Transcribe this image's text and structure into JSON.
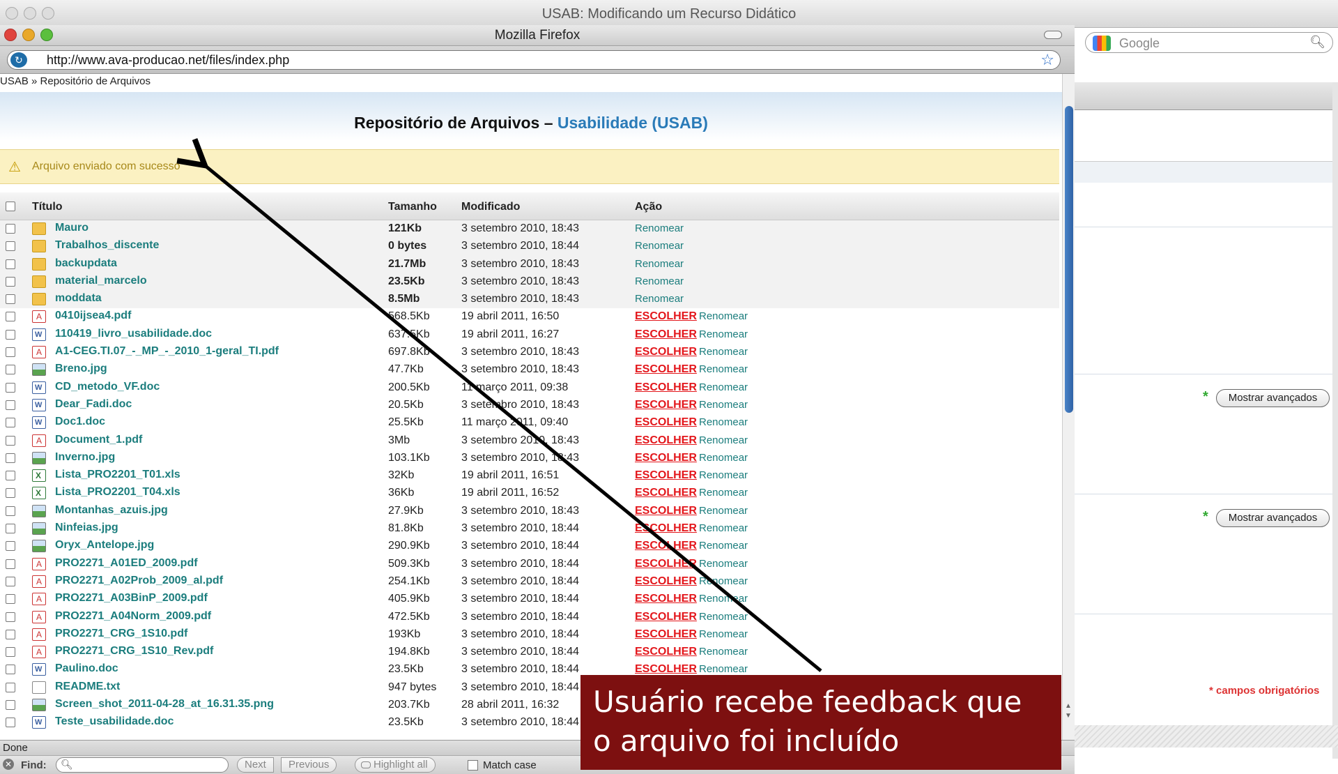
{
  "outer_window": {
    "title": "USAB: Modificando um Recurso Didático"
  },
  "search": {
    "placeholder": "Google"
  },
  "firefox": {
    "title": "Mozilla Firefox",
    "url": "http://www.ava-producao.net/files/index.php",
    "status": "Done"
  },
  "page": {
    "breadcrumb": "USAB » Repositório de Arquivos",
    "title": "Repositório de Arquivos –",
    "course": "Usabilidade (USAB)",
    "notice": "Arquivo enviado com sucesso",
    "columns": {
      "title": "Título",
      "size": "Tamanho",
      "modified": "Modificado",
      "action": "Ação"
    },
    "choose_label": "ESCOLHER",
    "rename_label": "Renomear"
  },
  "files": [
    {
      "name": "Mauro",
      "type": "folder",
      "size": "121Kb",
      "modified": "3 setembro 2010, 18:43"
    },
    {
      "name": "Trabalhos_discente",
      "type": "folder",
      "size": "0 bytes",
      "modified": "3 setembro 2010, 18:44"
    },
    {
      "name": "backupdata",
      "type": "folder",
      "size": "21.7Mb",
      "modified": "3 setembro 2010, 18:43"
    },
    {
      "name": "material_marcelo",
      "type": "folder",
      "size": "23.5Kb",
      "modified": "3 setembro 2010, 18:43"
    },
    {
      "name": "moddata",
      "type": "folder",
      "size": "8.5Mb",
      "modified": "3 setembro 2010, 18:43"
    },
    {
      "name": "0410ijsea4.pdf",
      "type": "pdf",
      "size": "568.5Kb",
      "modified": "19 abril 2011, 16:50"
    },
    {
      "name": "110419_livro_usabilidade.doc",
      "type": "doc",
      "size": "637.5Kb",
      "modified": "19 abril 2011, 16:27"
    },
    {
      "name": "A1-CEG.TI.07_-_MP_-_2010_1-geral_TI.pdf",
      "type": "pdf",
      "size": "697.8Kb",
      "modified": "3 setembro 2010, 18:43"
    },
    {
      "name": "Breno.jpg",
      "type": "jpg",
      "size": "47.7Kb",
      "modified": "3 setembro 2010, 18:43"
    },
    {
      "name": "CD_metodo_VF.doc",
      "type": "doc",
      "size": "200.5Kb",
      "modified": "11 março 2011, 09:38"
    },
    {
      "name": "Dear_Fadi.doc",
      "type": "doc",
      "size": "20.5Kb",
      "modified": "3 setembro 2010, 18:43"
    },
    {
      "name": "Doc1.doc",
      "type": "doc",
      "size": "25.5Kb",
      "modified": "11 março 2011, 09:40"
    },
    {
      "name": "Document_1.pdf",
      "type": "pdf",
      "size": "3Mb",
      "modified": "3 setembro 2010, 18:43"
    },
    {
      "name": "Inverno.jpg",
      "type": "jpg",
      "size": "103.1Kb",
      "modified": "3 setembro 2010, 18:43"
    },
    {
      "name": "Lista_PRO2201_T01.xls",
      "type": "xls",
      "size": "32Kb",
      "modified": "19 abril 2011, 16:51"
    },
    {
      "name": "Lista_PRO2201_T04.xls",
      "type": "xls",
      "size": "36Kb",
      "modified": "19 abril 2011, 16:52"
    },
    {
      "name": "Montanhas_azuis.jpg",
      "type": "jpg",
      "size": "27.9Kb",
      "modified": "3 setembro 2010, 18:43"
    },
    {
      "name": "Ninfeias.jpg",
      "type": "jpg",
      "size": "81.8Kb",
      "modified": "3 setembro 2010, 18:44"
    },
    {
      "name": "Oryx_Antelope.jpg",
      "type": "jpg",
      "size": "290.9Kb",
      "modified": "3 setembro 2010, 18:44"
    },
    {
      "name": "PRO2271_A01ED_2009.pdf",
      "type": "pdf",
      "size": "509.3Kb",
      "modified": "3 setembro 2010, 18:44"
    },
    {
      "name": "PRO2271_A02Prob_2009_al.pdf",
      "type": "pdf",
      "size": "254.1Kb",
      "modified": "3 setembro 2010, 18:44"
    },
    {
      "name": "PRO2271_A03BinP_2009.pdf",
      "type": "pdf",
      "size": "405.9Kb",
      "modified": "3 setembro 2010, 18:44"
    },
    {
      "name": "PRO2271_A04Norm_2009.pdf",
      "type": "pdf",
      "size": "472.5Kb",
      "modified": "3 setembro 2010, 18:44"
    },
    {
      "name": "PRO2271_CRG_1S10.pdf",
      "type": "pdf",
      "size": "193Kb",
      "modified": "3 setembro 2010, 18:44"
    },
    {
      "name": "PRO2271_CRG_1S10_Rev.pdf",
      "type": "pdf",
      "size": "194.8Kb",
      "modified": "3 setembro 2010, 18:44"
    },
    {
      "name": "Paulino.doc",
      "type": "doc",
      "size": "23.5Kb",
      "modified": "3 setembro 2010, 18:44"
    },
    {
      "name": "README.txt",
      "type": "txt",
      "size": "947 bytes",
      "modified": "3 setembro 2010, 18:44"
    },
    {
      "name": "Screen_shot_2011-04-28_at_16.31.35.png",
      "type": "png",
      "size": "203.7Kb",
      "modified": "28 abril 2011, 16:32"
    },
    {
      "name": "Teste_usabilidade.doc",
      "type": "doc",
      "size": "23.5Kb",
      "modified": "3 setembro 2010, 18:44"
    }
  ],
  "right_panel": {
    "advanced_button_1": "Mostrar avançados",
    "advanced_button_2": "Mostrar avançados",
    "required_note": "* campos obrigatórios"
  },
  "findbar": {
    "label": "Find:",
    "next": "Next",
    "previous": "Previous",
    "highlight": "Highlight all",
    "match_case": "Match case"
  },
  "annotation": {
    "text": "Usuário recebe feedback que o arquivo foi incluído",
    "color": "#7d1010"
  }
}
